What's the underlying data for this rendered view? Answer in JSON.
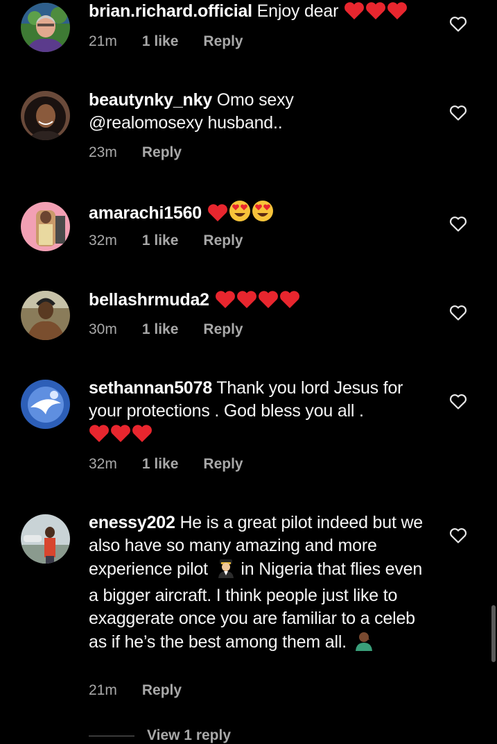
{
  "comments": [
    {
      "username": "brian.richard.official",
      "text": " Enjoy dear",
      "emoji": [
        "heart",
        "heart",
        "heart"
      ],
      "time": "21m",
      "likes": "1 like",
      "reply": "Reply"
    },
    {
      "username": "beautynky_nky",
      "text": " Omo sexy @realomosexy  husband..",
      "time": "23m",
      "reply": "Reply"
    },
    {
      "username": "amarachi1560",
      "text": " ",
      "emoji": [
        "heart",
        "heart-eyes",
        "heart-eyes"
      ],
      "time": "32m",
      "likes": "1 like",
      "reply": "Reply"
    },
    {
      "username": "bellashrmuda2",
      "text": " ",
      "emoji": [
        "heart",
        "heart",
        "heart",
        "heart"
      ],
      "time": "30m",
      "likes": "1 like",
      "reply": "Reply"
    },
    {
      "username": "sethannan5078",
      "text": " Thank you lord Jesus for your protections . God bless you all .",
      "emoji": [
        "heart",
        "heart",
        "heart"
      ],
      "time": "32m",
      "likes": "1 like",
      "reply": "Reply"
    },
    {
      "username": "enessy202",
      "text": " He is a great pilot indeed but we also have so many amazing and more experience pilot",
      "text2": " in Nigeria that flies even a bigger aircraft. I think people just like to exaggerate once you are familiar to a celeb as if he’s the best among them all.",
      "emoji_inline": "pilot",
      "emoji_end": "facepalm",
      "time": "21m",
      "reply": "Reply"
    }
  ],
  "view_replies": "View 1 reply",
  "icons": {
    "like": "heart-outline-icon",
    "heart_emoji_color": "#e8262e",
    "heart_eyes_face_color": "#f7c33a"
  },
  "colors": {
    "background": "#000000",
    "text": "#f5f5f5",
    "meta": "#a8a8a8"
  }
}
